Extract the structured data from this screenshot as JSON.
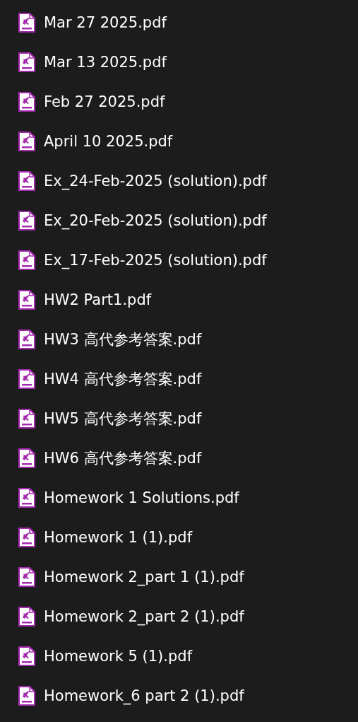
{
  "files": [
    {
      "name": "Mar 27 2025.pdf"
    },
    {
      "name": "Mar 13 2025.pdf"
    },
    {
      "name": "Feb 27 2025.pdf"
    },
    {
      "name": "April 10 2025.pdf"
    },
    {
      "name": "Ex_24-Feb-2025 (solution).pdf"
    },
    {
      "name": "Ex_20-Feb-2025 (solution).pdf"
    },
    {
      "name": "Ex_17-Feb-2025 (solution).pdf"
    },
    {
      "name": "HW2 Part1.pdf"
    },
    {
      "name": "HW3 高代参考答案.pdf"
    },
    {
      "name": "HW4 高代参考答案.pdf"
    },
    {
      "name": "HW5 高代参考答案.pdf"
    },
    {
      "name": "HW6 高代参考答案.pdf"
    },
    {
      "name": "Homework 1 Solutions.pdf"
    },
    {
      "name": "Homework 1 (1).pdf"
    },
    {
      "name": "Homework 2_part 1 (1).pdf"
    },
    {
      "name": "Homework 2_part 2 (1).pdf"
    },
    {
      "name": "Homework 5 (1).pdf"
    },
    {
      "name": "Homework_6 part 2 (1).pdf"
    }
  ]
}
